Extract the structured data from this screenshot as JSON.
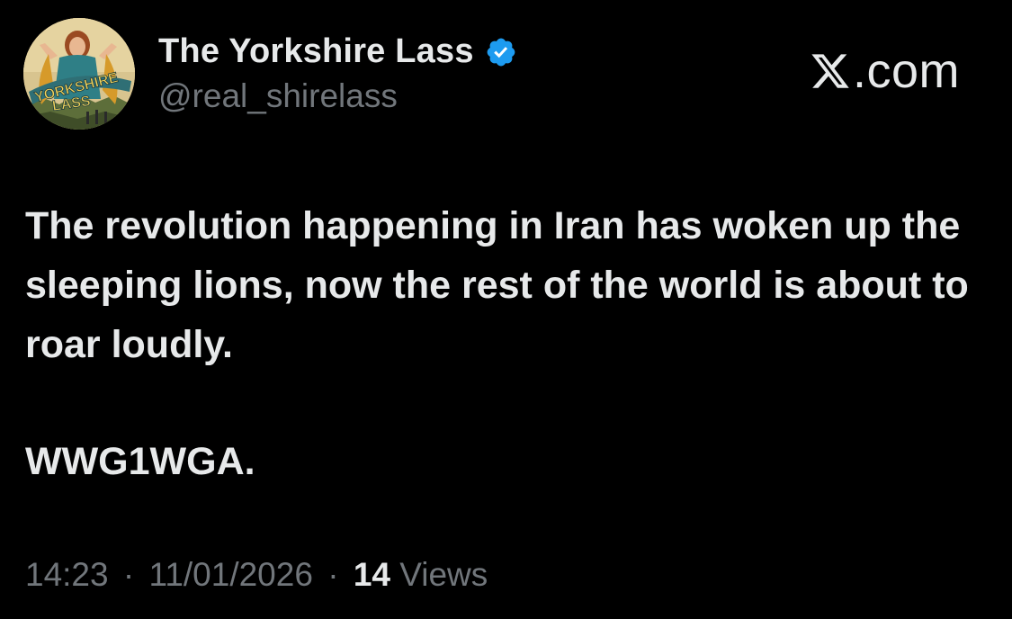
{
  "tweet": {
    "author": {
      "display_name": "The Yorkshire Lass",
      "handle": "@real_shirelass",
      "verified": true,
      "avatar_text_line1": "YORKSHIRE",
      "avatar_text_line2": "LASS"
    },
    "brand": {
      "text": ".com",
      "icon": "x-logo-icon"
    },
    "text_lines": [
      "The revolution happening in Iran has woken up the sleeping lions, now the rest of the world is about to roar loudly."
    ],
    "tag_line": "WWG1WGA.",
    "meta": {
      "time": "14:23",
      "separator": "·",
      "date": "11/01/2026",
      "views_count": "14",
      "views_label": "Views"
    }
  },
  "colors": {
    "background": "#000000",
    "text_primary": "#e7e9ea",
    "text_secondary": "#71767b",
    "verified_blue": "#1d9bf0"
  }
}
